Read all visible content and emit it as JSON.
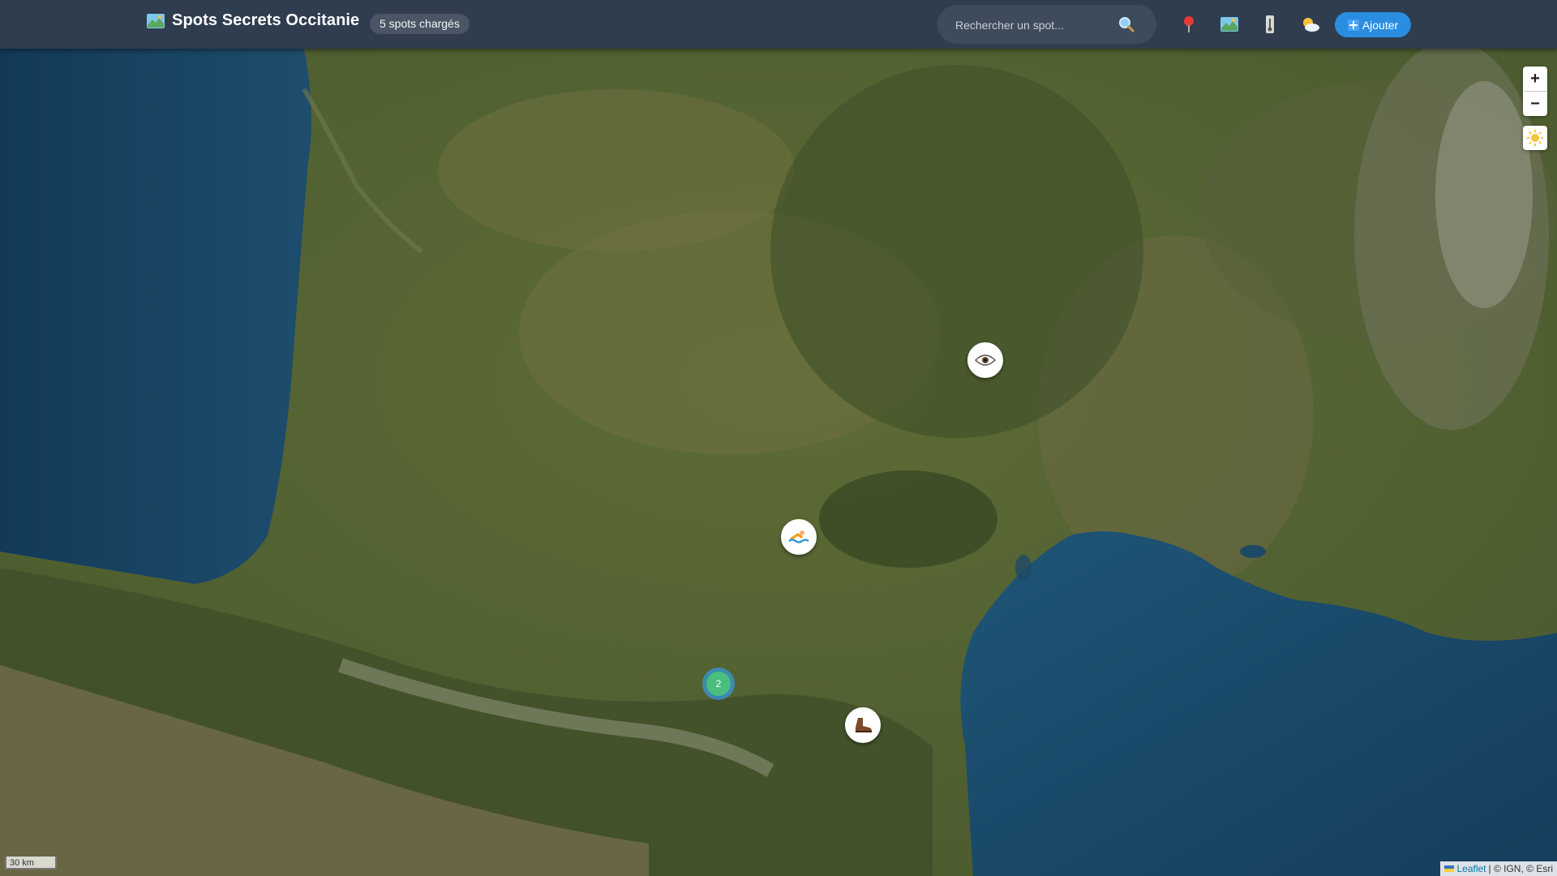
{
  "header": {
    "app_title": "Spots Secrets Occitanie",
    "logo_icon": "map-icon",
    "spots_badge": "5 spots chargés",
    "search_placeholder": "Rechercher un spot...",
    "search_icon": "magnifier-icon",
    "tools": [
      {
        "name": "pin-tool",
        "icon": "pin-icon"
      },
      {
        "name": "map-tool",
        "icon": "map-icon"
      },
      {
        "name": "thermometer-tool",
        "icon": "thermometer-icon"
      },
      {
        "name": "weather-tool",
        "icon": "sun-cloud-icon"
      }
    ],
    "add_button_label": "Ajouter"
  },
  "map": {
    "zoom_in_label": "+",
    "zoom_out_label": "−",
    "theme_icon": "sun-icon",
    "markers": [
      {
        "name": "spot-viewpoint",
        "icon": "eye-icon"
      },
      {
        "name": "spot-swimming",
        "icon": "swimmer-icon"
      },
      {
        "name": "spot-hiking",
        "icon": "boot-icon"
      }
    ],
    "cluster_count": "2",
    "scale_label": "30 km",
    "attribution_link": "Leaflet",
    "attribution_text": "| © IGN, © Esri"
  },
  "colors": {
    "header_bg": "#2f3d4f",
    "accent": "#2a8de0",
    "sea": "#1f4a66",
    "land": "#5c6a3a"
  }
}
